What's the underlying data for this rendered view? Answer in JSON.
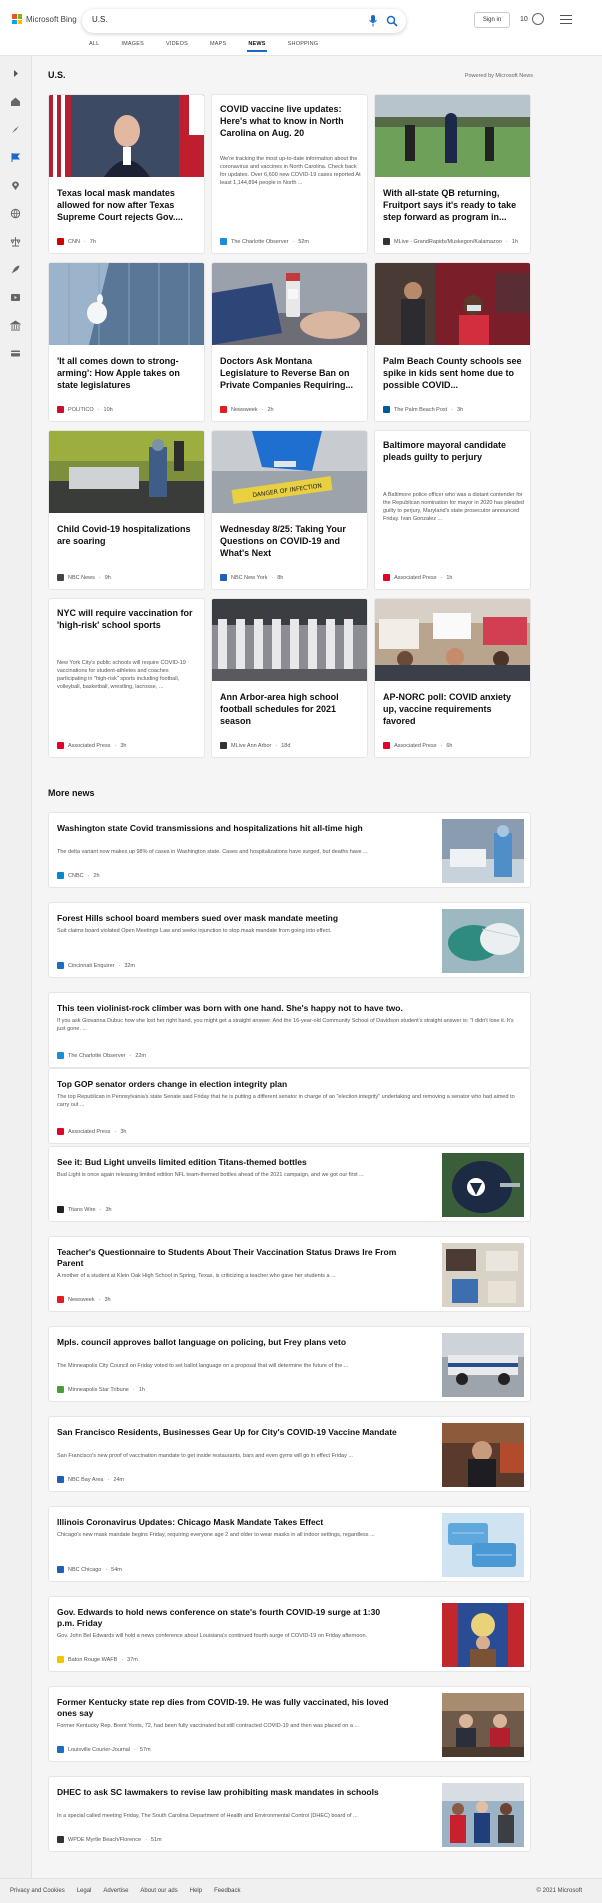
{
  "header": {
    "logo_text": "Microsoft Bing",
    "search_value": "U.S.",
    "signin_label": "Sign in",
    "rewards_count": "10",
    "tabs": [
      {
        "label": "ALL"
      },
      {
        "label": "IMAGES"
      },
      {
        "label": "VIDEOS"
      },
      {
        "label": "MAPS"
      },
      {
        "label": "NEWS"
      },
      {
        "label": "SHOPPING"
      }
    ],
    "active_tab": "NEWS"
  },
  "sidebar": {
    "icons": [
      "chevron-right-icon",
      "home-icon",
      "compass-icon",
      "flag-icon",
      "location-icon",
      "globe-icon",
      "scale-icon",
      "rocket-icon",
      "film-icon",
      "bank-icon",
      "card-icon"
    ]
  },
  "main": {
    "section_title": "U.S.",
    "powered_by": "Powered by Microsoft News",
    "cards": [
      {
        "title": "Texas local mask mandates allowed for now after Texas Supreme Court rejects Gov....",
        "source": "CNN",
        "time": "7h",
        "image": "governor",
        "icon_color": "#cc0000"
      },
      {
        "title": "COVID vaccine live updates: Here's what to know in North Carolina on Aug. 20",
        "snippet": "We're tracking the most up-to-date information about the coronavirus and vaccines in North Carolina. Check back for updates. Over 6,600 new COVID-19 cases reported At least 1,144,894 people in North ...",
        "source": "The Charlotte Observer",
        "time": "52m",
        "image": "",
        "icon_color": "#1a8fd6"
      },
      {
        "title": "With all-state QB returning, Fruitport says it's ready to take step forward as program in...",
        "source": "MLive - GrandRapids/Muskegon/Kalamazoo",
        "time": "1h",
        "image": "football",
        "icon_color": "#333333"
      },
      {
        "title": "'It all comes down to strong-arming': How Apple takes on state legislatures",
        "source": "POLITICO",
        "time": "10h",
        "image": "apple",
        "icon_color": "#c8102e"
      },
      {
        "title": "Doctors Ask Montana Legislature to Reverse Ban on Private Companies Requiring...",
        "source": "Newsweek",
        "time": "2h",
        "image": "vaccine",
        "icon_color": "#e31b23"
      },
      {
        "title": "Palm Beach County schools see spike in kids sent home due to possible COVID...",
        "source": "The Palm Beach Post",
        "time": "3h",
        "image": "school",
        "icon_color": "#005a9c"
      },
      {
        "title": "Child Covid-19 hospitalizations are soaring",
        "source": "NBC News",
        "time": "9h",
        "image": "hospital",
        "icon_color": "#444444"
      },
      {
        "title": "Wednesday 8/25: Taking Your Questions on COVID-19 and What's Next",
        "source": "NBC New York",
        "time": "8h",
        "image": "lab",
        "icon_color": "#1f5fb5"
      },
      {
        "title": "Baltimore mayoral candidate pleads guilty to perjury",
        "snippet": "A Baltimore police officer who was a distant contender for the Republican nomination for mayor in 2020 has pleaded guilty to perjury, Maryland's state prosecutor announced Friday. Ivan Gonzalez ...",
        "source": "Associated Press",
        "time": "1h",
        "image": "",
        "icon_color": "#e4002b"
      },
      {
        "title": "NYC will require vaccination for 'high-risk' school sports",
        "snippet": "New York City's public schools will require COVID-19 vaccinations for student-athletes and coaches participating in \"high-risk\" sports including football, volleyball, basketball, wrestling, lacrosse, ...",
        "source": "Associated Press",
        "time": "3h",
        "image": "",
        "icon_color": "#e4002b"
      },
      {
        "title": "Ann Arbor-area high school football schedules for 2021 season",
        "source": "MLive Ann Arbor",
        "time": "18d",
        "image": "legs",
        "icon_color": "#333333"
      },
      {
        "title": "AP-NORC poll: COVID anxiety up, vaccine requirements favored",
        "source": "Associated Press",
        "time": "6h",
        "image": "protest",
        "icon_color": "#e4002b"
      }
    ],
    "more_title": "More news",
    "rows": [
      {
        "title": "Washington state Covid transmissions and hospitalizations hit all-time high",
        "snippet": "The delta variant now makes up 98% of cases in Washington state. Cases and hospitalizations have surged, but deaths have ...",
        "source": "CNBC",
        "time": "2h",
        "image": "ward",
        "icon_color": "#0089d0"
      },
      {
        "title": "Forest Hills school board members sued over mask mandate meeting",
        "snippet": "Suit claims board violated Open Meetings Law and seeks injunction to stop mask mandate from going into effect.",
        "source": "Cincinnati Enquirer",
        "time": "32m",
        "image": "mask",
        "icon_color": "#1a6dc2"
      },
      {
        "title": "This teen violinist-rock climber was born with one hand. She's happy not to have two.",
        "snippet": "If you ask Giovanna Dubuc how she lost her right hand, you might get a straight answer. And the 16-year-old Community School of Davidson student's straight answer is: \"I didn't lose it. It's just gone. ...",
        "source": "The Charlotte Observer",
        "time": "22m",
        "image": "",
        "icon_color": "#1a8fd6"
      },
      {
        "title": "Top GOP senator orders change in election integrity plan",
        "snippet": "The top Republican in Pennsylvania's state Senate said Friday that he is putting a different senator in charge of an \"election integrity\" undertaking and removing a senator who had aimed to carry out ...",
        "source": "Associated Press",
        "time": "3h",
        "image": "",
        "icon_color": "#e4002b"
      },
      {
        "title": "See it: Bud Light unveils limited edition Titans-themed bottles",
        "snippet": "Bud Light is once again releasing limited edition NFL team-themed bottles ahead of the 2021 campaign, and we got our first ...",
        "source": "Titans Wire",
        "time": "3h",
        "image": "helmet",
        "icon_color": "#222222"
      },
      {
        "title": "Teacher's Questionnaire to Students About Their Vaccination Status Draws Ire From Parent",
        "snippet": "A mother of a student at Klein Oak High School in Spring, Texas, is criticizing a teacher who gave her students a ...",
        "source": "Newsweek",
        "time": "3h",
        "image": "classroom",
        "icon_color": "#e31b23"
      },
      {
        "title": "Mpls. council approves ballot language on policing, but Frey plans veto",
        "snippet": "The Minneapolis City Council on Friday voted to set ballot language on a proposal that will determine the future of the ...",
        "source": "Minneapolis Star Tribune",
        "time": "1h",
        "image": "police",
        "icon_color": "#4a9d3a"
      },
      {
        "title": "San Francisco Residents, Businesses Gear Up for City's COVID-19 Vaccine Mandate",
        "snippet": "San Francisco's new proof of vaccination mandate to get inside restaurants, bars and even gyms will go in effect Friday ...",
        "source": "NBC Bay Area",
        "time": "24m",
        "image": "restaurant",
        "icon_color": "#1f5fb5"
      },
      {
        "title": "Illinois Coronavirus Updates: Chicago Mask Mandate Takes Effect",
        "snippet": "Chicago's new mask mandate begins Friday, requiring everyone age 2 and older to wear masks in all indoor settings, regardless ...",
        "source": "NBC Chicago",
        "time": "54m",
        "image": "bluemasks",
        "icon_color": "#1f5fb5"
      },
      {
        "title": "Gov. Edwards to hold news conference on state's fourth COVID-19 surge at 1:30 p.m. Friday",
        "snippet": "Gov. John Bel Edwards will hold a news conference about Louisiana's continued fourth surge of COVID-19 on Friday afternoon.",
        "source": "Baton Rouge WAFB",
        "time": "37m",
        "image": "podium",
        "icon_color": "#f2c500"
      },
      {
        "title": "Former Kentucky state rep dies from COVID-19. He was fully vaccinated, his loved ones say",
        "snippet": "Former Kentucky Rep. Brent Yonts, 72, had been fully vaccinated but still contracted COVID-19 and then was placed on a ...",
        "source": "Louisville Courier-Journal",
        "time": "57m",
        "image": "legislators",
        "icon_color": "#1a6dc2"
      },
      {
        "title": "DHEC to ask SC lawmakers to revise law prohibiting mask mandates in schools",
        "snippet": "In a special called meeting Friday, The South Carolina Department of Health and Environmental Control (DHEC) board of ...",
        "source": "WPDE Myrtle Beach/Florence",
        "time": "51m",
        "image": "kids",
        "icon_color": "#333333"
      }
    ]
  },
  "footer": {
    "links": [
      "Privacy and Cookies",
      "Legal",
      "Advertise",
      "About our ads",
      "Help",
      "Feedback"
    ],
    "copyright": "© 2021 Microsoft"
  }
}
